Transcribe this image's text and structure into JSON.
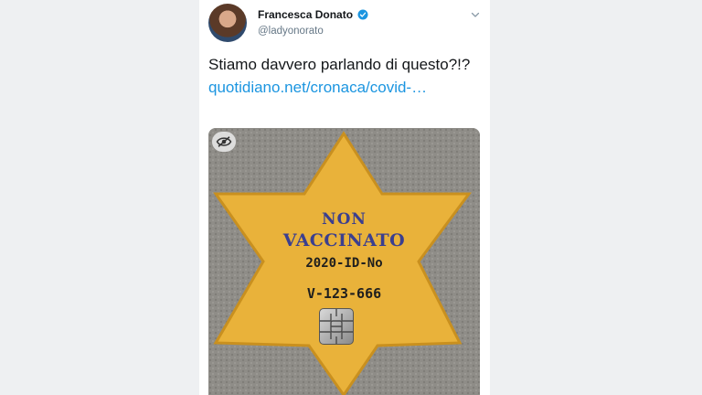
{
  "tweet": {
    "display_name": "Francesca Donato",
    "handle": "@ladyonorato",
    "text": "Stiamo davvero parlando di questo?!? ",
    "link_text": "quotidiano.net/cronaca/covid-…",
    "verified_icon": "verified-badge-icon",
    "menu_icon": "chevron-down-icon",
    "accent_color": "#1b95e0"
  },
  "media": {
    "sensitive_icon": "eye-slash-icon",
    "star_lines": [
      "NON",
      "VACCINATO",
      "2020-ID-No",
      "V-123-666"
    ],
    "star_color": "#e9b23a",
    "text_color": "#3b3f8f",
    "chip_icon": "sim-chip-icon"
  }
}
